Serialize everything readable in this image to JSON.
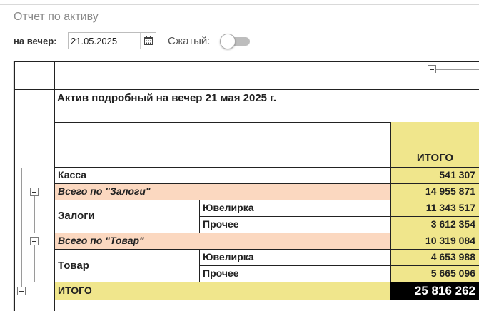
{
  "page": {
    "title": "Отчет по активу",
    "date_label": "на вечер:",
    "date_value": "21.05.2025",
    "compact_label": "Сжатый:",
    "compact_on": false
  },
  "report": {
    "heading": "Актив подробный на вечер 21 мая 2025 г.",
    "total_header": "ИТОГО",
    "rows": [
      {
        "label": "Касса",
        "sub": "",
        "value": "541 307"
      },
      {
        "label": "Всего по \"Залоги\"",
        "sub": "",
        "value": "14 955 871"
      },
      {
        "label": "Залоги",
        "sub": "Ювелирка",
        "value": "11 343 517"
      },
      {
        "label": "",
        "sub": "Прочее",
        "value": "3 612 354"
      },
      {
        "label": "Всего по \"Товар\"",
        "sub": "",
        "value": "10 319 084"
      },
      {
        "label": "Товар",
        "sub": "Ювелирка",
        "value": "4 653 988"
      },
      {
        "label": "",
        "sub": "Прочее",
        "value": "5 665 096"
      }
    ],
    "grand_total_label": "ИТОГО",
    "grand_total_value": "25 816 262"
  },
  "icons": {
    "calendar": "calendar-icon",
    "collapse": "minus-box-icon"
  }
}
